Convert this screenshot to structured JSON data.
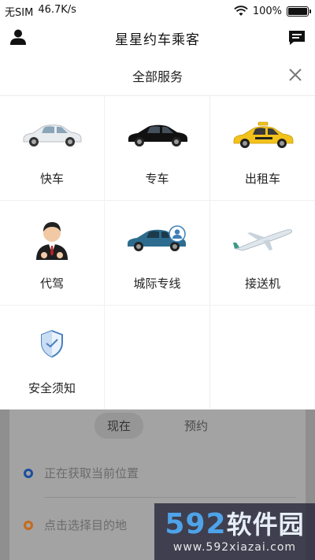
{
  "status_bar": {
    "carrier": "无SIM",
    "speed": "46.7K/s",
    "battery": "100%"
  },
  "nav": {
    "title": "星星约车乘客",
    "left_icon": "user-icon",
    "right_icon": "message-icon"
  },
  "services_sheet": {
    "title": "全部服务",
    "close_icon": "close-icon",
    "items": [
      {
        "label": "快车",
        "icon": "white-car-icon"
      },
      {
        "label": "专车",
        "icon": "black-car-icon"
      },
      {
        "label": "出租车",
        "icon": "taxi-icon"
      },
      {
        "label": "代驾",
        "icon": "driver-icon"
      },
      {
        "label": "城际专线",
        "icon": "intercity-car-icon"
      },
      {
        "label": "接送机",
        "icon": "airplane-icon"
      },
      {
        "label": "安全须知",
        "icon": "shield-icon"
      }
    ]
  },
  "background_panel": {
    "tabs": [
      {
        "label": "现在",
        "active": true
      },
      {
        "label": "预约",
        "active": false
      }
    ],
    "pickup_placeholder": "正在获取当前位置",
    "destination_placeholder": "点击选择目的地"
  },
  "watermark": {
    "digits": "592",
    "text": "软件园",
    "url": "www.592xiazai.com"
  },
  "colors": {
    "overlay": "#8f8f8f",
    "pickup_dot": "#1c4e9e",
    "destination_dot": "#c46b1c",
    "taxi_yellow": "#f2c21b"
  }
}
